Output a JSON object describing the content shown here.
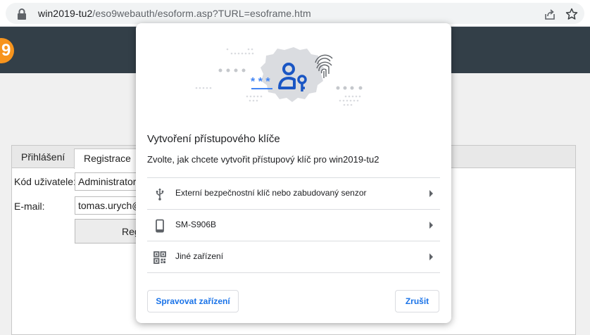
{
  "browser": {
    "url_host": "win2019-tu2",
    "url_path": "/eso9webauth/esoform.asp?TURL=esoframe.htm"
  },
  "site": {
    "logo_text": "9",
    "tabs": [
      {
        "label": "Přihlášení"
      },
      {
        "label": "Registrace"
      }
    ],
    "form": {
      "user_label": "Kód uživatele:",
      "user_value": "Administrator",
      "email_label": "E-mail:",
      "email_value": "tomas.urych@",
      "submit_label": "Reg"
    }
  },
  "dialog": {
    "title": "Vytvoření přístupového klíče",
    "subtitle": "Zvolte, jak chcete vytvořit přístupový klíč pro win2019-tu2",
    "options": [
      {
        "label": "Externí bezpečnostní klíč nebo zabudovaný senzor",
        "icon": "usb-icon"
      },
      {
        "label": "SM-S906B",
        "icon": "phone-icon"
      },
      {
        "label": "Jiné zařízení",
        "icon": "qr-code-icon"
      }
    ],
    "manage_button": "Spravovat zařízení",
    "cancel_button": "Zrušit",
    "accent_color": "#1a73e8"
  }
}
